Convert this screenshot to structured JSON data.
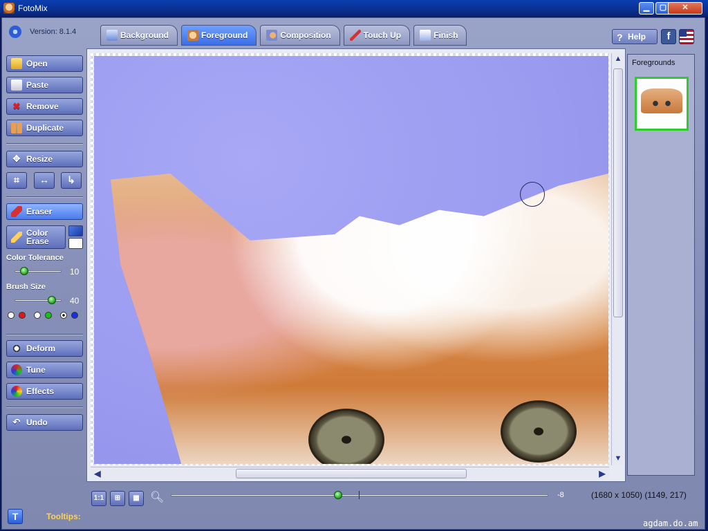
{
  "window": {
    "title": "FotoMix",
    "minimize": "▁",
    "maximize": "▢",
    "close": "✕"
  },
  "version": "Version: 8.1.4",
  "tabs": [
    {
      "label": "Background",
      "icon": "background-icon",
      "active": false
    },
    {
      "label": "Foreground",
      "icon": "foreground-icon",
      "active": true
    },
    {
      "label": "Composition",
      "icon": "composition-icon",
      "active": false
    },
    {
      "label": "Touch Up",
      "icon": "touchup-icon",
      "active": false
    },
    {
      "label": "Finish",
      "icon": "finish-icon",
      "active": false
    }
  ],
  "header_buttons": {
    "help": "Help",
    "facebook": "f"
  },
  "toolbar": {
    "open": "Open",
    "paste": "Paste",
    "remove": "Remove",
    "duplicate": "Duplicate",
    "resize": "Resize",
    "crop": "⌗",
    "flip": "↔",
    "rotate": "↳",
    "eraser": "Eraser",
    "color_erase_line1": "Color",
    "color_erase_line2": "Erase",
    "color_tolerance_label": "Color Tolerance",
    "color_tolerance_value": "10",
    "brush_size_label": "Brush Size",
    "brush_size_value": "40",
    "deform": "Deform",
    "tune": "Tune",
    "effects": "Effects",
    "undo": "Undo"
  },
  "color_tolerance": 10,
  "brush_size": 40,
  "foregrounds_panel": {
    "title": "Foregrounds"
  },
  "bottom_bar": {
    "actual_size": "1:1",
    "fit": "⊞",
    "grid": "▦",
    "zoom_value": "-8",
    "status": "(1680 x 1050) (1149, 217)"
  },
  "tooltips": {
    "button": "T",
    "label": "Tooltips:"
  },
  "watermark": "agdam.do.am",
  "colors": {
    "accent": "#3b6ee6",
    "selected_thumb": "#2fcc2f",
    "tooltips_label": "#ffd24a"
  }
}
